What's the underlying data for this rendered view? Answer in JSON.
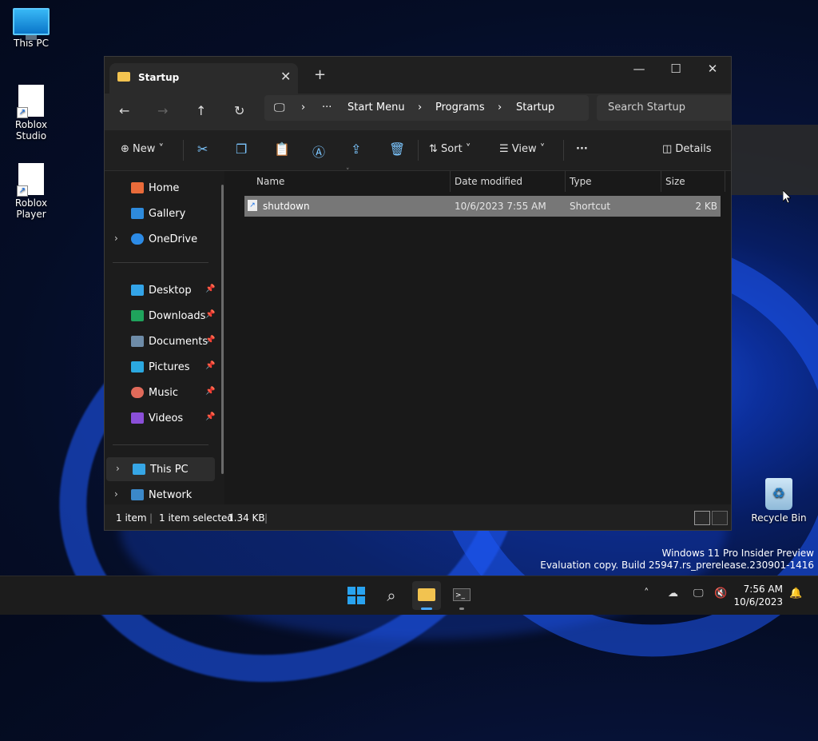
{
  "desktop": {
    "icons": [
      "This PC",
      "Roblox Studio",
      "Roblox Player",
      "Recycle Bin"
    ],
    "watermark": [
      "Windows 11 Pro Insider Preview",
      "Evaluation copy. Build 25947.rs_prerelease.230901-1416"
    ]
  },
  "explorer": {
    "tab_title": "Startup",
    "breadcrumb": [
      "Start Menu",
      "Programs",
      "Startup"
    ],
    "search_placeholder": "Search Startup",
    "toolbar": {
      "new": "New",
      "sort": "Sort",
      "view": "View",
      "details": "Details"
    },
    "nav": {
      "home": "Home",
      "gallery": "Gallery",
      "onedrive": "OneDrive",
      "desktop": "Desktop",
      "downloads": "Downloads",
      "documents": "Documents",
      "pictures": "Pictures",
      "music": "Music",
      "videos": "Videos",
      "thispc": "This PC",
      "network": "Network"
    },
    "columns": {
      "name": "Name",
      "date": "Date modified",
      "type": "Type",
      "size": "Size"
    },
    "file": {
      "name": "shutdown",
      "date": "10/6/2023 7:55 AM",
      "type": "Shortcut",
      "size": "2 KB"
    },
    "status": {
      "count": "1 item",
      "selected": "1 item selected",
      "size": "1.34 KB"
    }
  },
  "taskbar": {
    "time": "7:56 AM",
    "date": "10/6/2023"
  },
  "colors": {
    "accent": "#0078d4",
    "folder": "#f2c350"
  }
}
